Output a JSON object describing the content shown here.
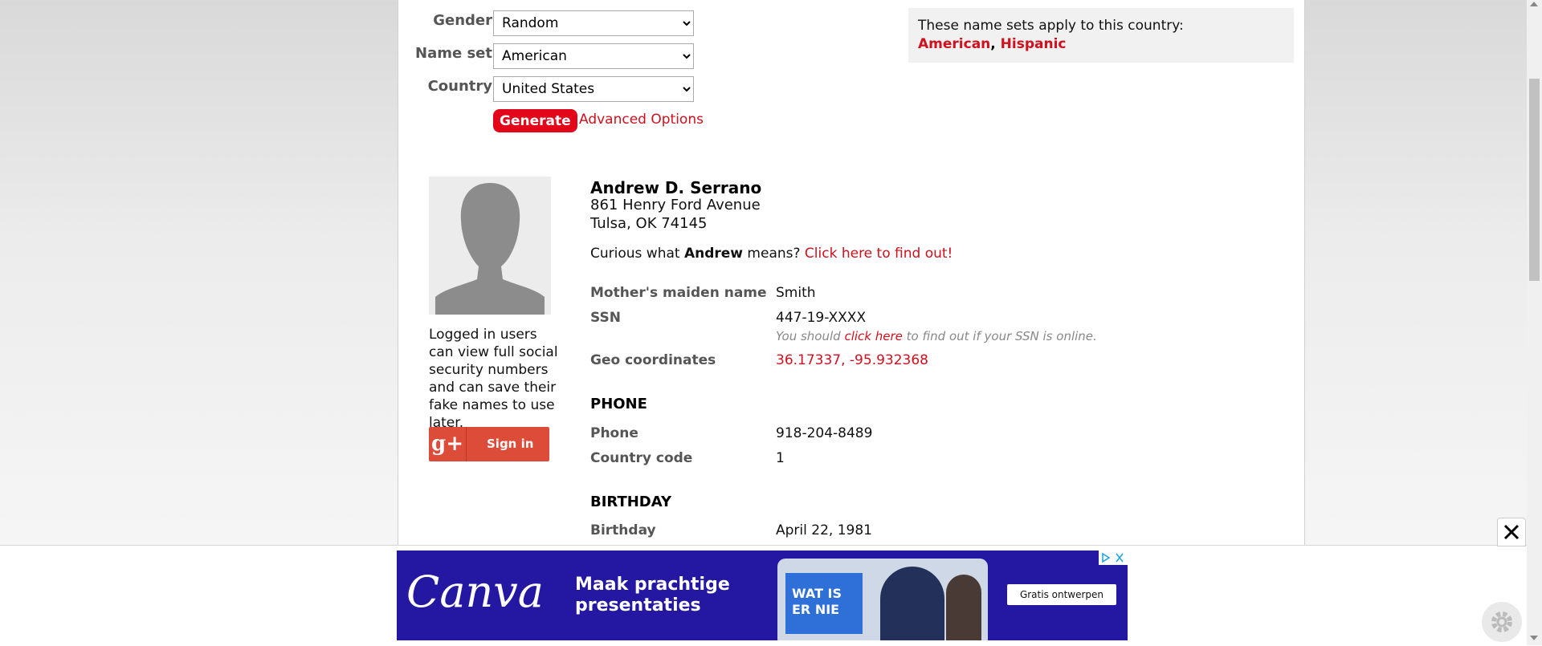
{
  "form": {
    "gender_label": "Gender",
    "gender_value": "Random",
    "nameset_label": "Name set",
    "nameset_value": "American",
    "country_label": "Country",
    "country_value": "United States",
    "generate_label": "Generate",
    "advanced_label": "Advanced Options"
  },
  "info": {
    "text": "These name sets apply to this country:",
    "set1": "American",
    "sep": ",",
    "set2": "Hispanic"
  },
  "sidebar": {
    "note": "Logged in users can view full social security numbers and can save their fake names to use later.",
    "signin_label": "Sign in",
    "gplus": "g+"
  },
  "person": {
    "name": "Andrew D. Serrano",
    "address1": "861 Henry Ford Avenue",
    "address2": "Tulsa, OK 74145",
    "curious_pre": "Curious what",
    "curious_name": "Andrew",
    "curious_post": "means?",
    "curious_link": "Click here to find out!"
  },
  "details": {
    "maiden_label": "Mother's maiden name",
    "maiden_value": "Smith",
    "ssn_label": "SSN",
    "ssn_value": "447-19-XXXX",
    "ssn_note_pre": "You should",
    "ssn_note_link": "click here",
    "ssn_note_post": "to find out if your SSN is online.",
    "geo_label": "Geo coordinates",
    "geo_value": "36.17337, -95.932368"
  },
  "phone": {
    "heading": "PHONE",
    "phone_label": "Phone",
    "phone_value": "918-204-8489",
    "cc_label": "Country code",
    "cc_value": "1"
  },
  "birthday": {
    "heading": "BIRTHDAY",
    "bday_label": "Birthday",
    "bday_value": "April 22, 1981"
  },
  "ad": {
    "brand": "Canva",
    "headline": "Maak prachtige presentaties",
    "slide_text": "WAT IS ER NIE",
    "cta": "Gratis ontwerpen"
  },
  "colors": {
    "accent": "#e3061b",
    "ad_bg": "#2418a3"
  }
}
